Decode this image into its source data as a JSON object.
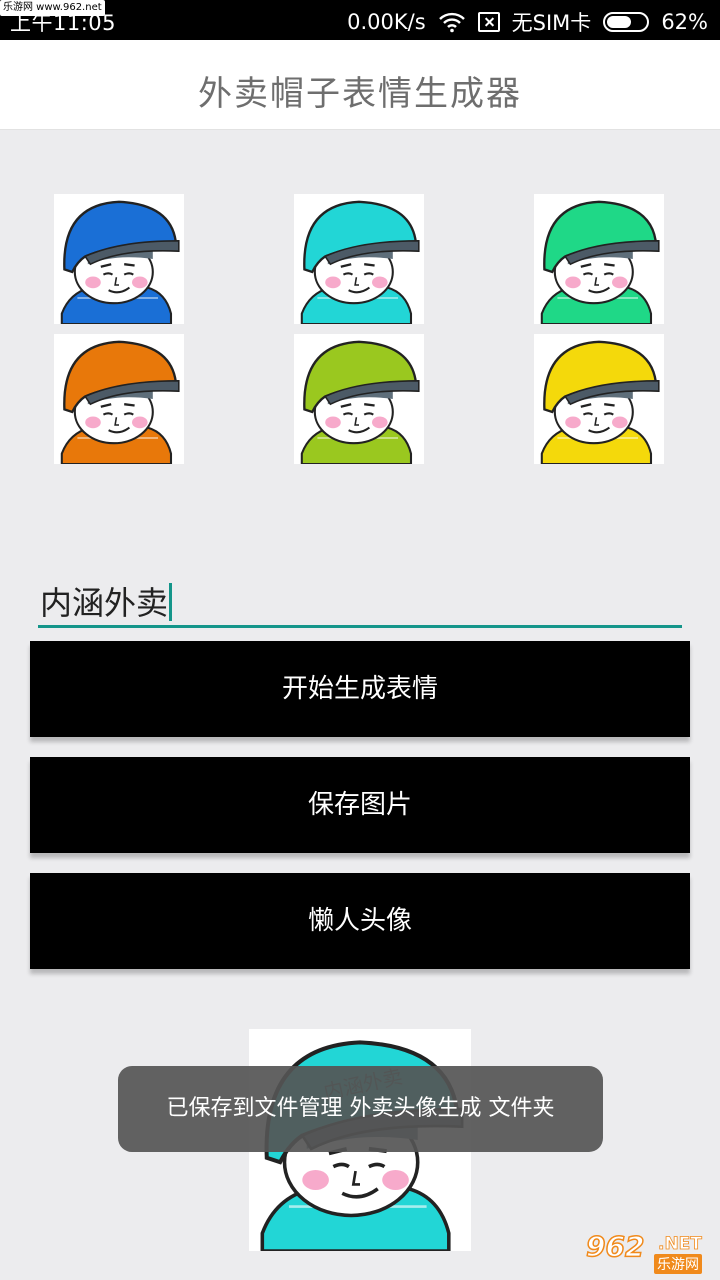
{
  "status_bar": {
    "time": "上午11:05",
    "top_watermark": "乐游网 www.962.net",
    "speed": "0.00K/s",
    "sim": "无SIM卡",
    "battery": "62%",
    "battery_level": 0.62
  },
  "app": {
    "title": "外卖帽子表情生成器"
  },
  "helmets": [
    {
      "name": "blue",
      "color": "#1a6fd6"
    },
    {
      "name": "cyan",
      "color": "#22d6d6"
    },
    {
      "name": "green",
      "color": "#1fd887"
    },
    {
      "name": "orange",
      "color": "#e8780a"
    },
    {
      "name": "lime",
      "color": "#9ac81f"
    },
    {
      "name": "yellow",
      "color": "#f4d90b"
    }
  ],
  "input": {
    "value": "内涵外卖"
  },
  "buttons": {
    "generate": "开始生成表情",
    "save": "保存图片",
    "lazy_avatar": "懒人头像"
  },
  "preview": {
    "helmet_color": "#22d6d6",
    "helmet_text": "内涵外卖"
  },
  "toast": {
    "message": "已保存到文件管理  外卖头像生成  文件夹"
  },
  "watermark": {
    "number": "962",
    "net": ".NET",
    "sub": "乐游网"
  },
  "colors": {
    "accent": "#14958a"
  }
}
